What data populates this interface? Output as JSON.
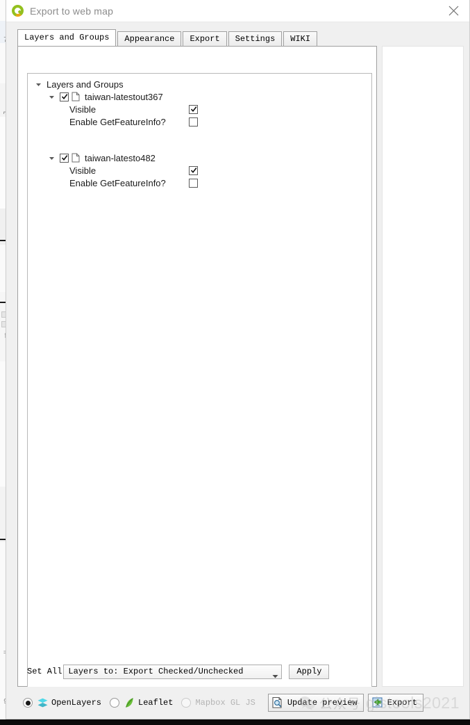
{
  "window": {
    "title": "Export to web map",
    "logo_icon": "qgis-logo-icon",
    "close_icon": "close-icon"
  },
  "tabs": [
    {
      "label": "Layers and Groups",
      "active": true
    },
    {
      "label": "Appearance",
      "active": false
    },
    {
      "label": "Export",
      "active": false
    },
    {
      "label": "Settings",
      "active": false
    },
    {
      "label": "WIKI",
      "active": false
    }
  ],
  "tree": {
    "root": {
      "label": "Layers and Groups",
      "expanded": true,
      "arrow_icon": "chevron-down-icon"
    },
    "layers": [
      {
        "name": "taiwan-latestout367",
        "expanded": true,
        "export_checked": true,
        "arrow_icon": "chevron-down-icon",
        "layer_icon": "document-icon",
        "properties": [
          {
            "label": "Visible",
            "checked": true
          },
          {
            "label": "Enable GetFeatureInfo?",
            "checked": false
          }
        ]
      },
      {
        "name": "taiwan-latesto482",
        "expanded": true,
        "export_checked": true,
        "arrow_icon": "chevron-down-icon",
        "layer_icon": "document-icon",
        "properties": [
          {
            "label": "Visible",
            "checked": true
          },
          {
            "label": "Enable GetFeatureInfo?",
            "checked": false
          }
        ]
      }
    ]
  },
  "set_all": {
    "label": "Set All",
    "combo_value": "Layers to: Export Checked/Unchecked",
    "combo_arrow_icon": "chevron-down-icon",
    "apply_label": "Apply"
  },
  "bottom_bar": {
    "framework_options": [
      {
        "label": "OpenLayers",
        "selected": true,
        "disabled": false,
        "icon": "openlayers-icon"
      },
      {
        "label": "Leaflet",
        "selected": false,
        "disabled": false,
        "icon": "leaflet-icon"
      },
      {
        "label": "Mapbox GL JS",
        "selected": false,
        "disabled": true,
        "icon": "none"
      }
    ],
    "update_preview_label": "Update preview",
    "update_preview_icon": "preview-magnifier-icon",
    "export_label": "Export",
    "export_icon": "export-arrow-icon"
  },
  "watermark": {
    "cn_text": "公众号",
    "text": "gistools2021",
    "logo_icon": "wechat-icon"
  }
}
